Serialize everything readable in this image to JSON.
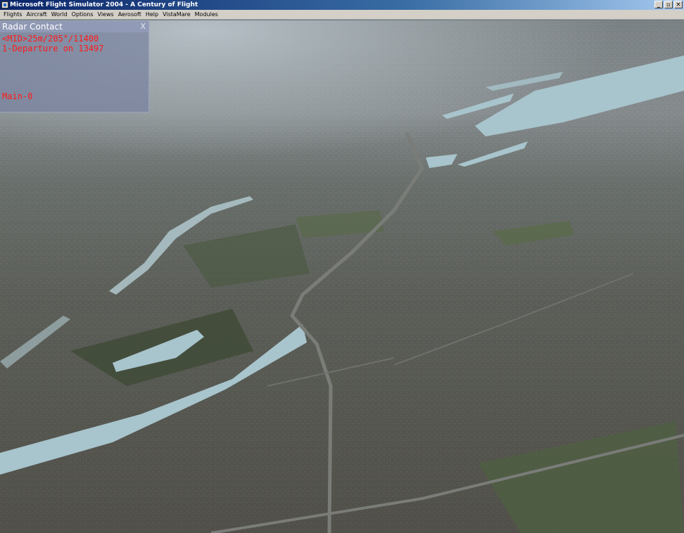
{
  "window": {
    "title": "Microsoft Flight Simulator 2004 - A Century of Flight",
    "controls": [
      "_",
      "▫",
      "✕"
    ]
  },
  "menu": [
    "Flights",
    "Aircraft",
    "World",
    "Options",
    "Views",
    "Aerosoft",
    "Help",
    "VistaMare",
    "Modules"
  ],
  "radar": {
    "title": "Radar Contact",
    "close": "X",
    "lines": [
      "<MID>25m/205°/11400",
      "1-Departure on  13497",
      "Main-0"
    ]
  },
  "colors": {
    "title_bar": "#0a246a",
    "menu_bg": "#d4d0c8",
    "radar_text": "#ff1a1a"
  }
}
